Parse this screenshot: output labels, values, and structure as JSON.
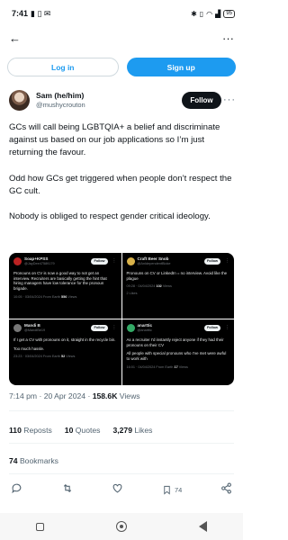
{
  "status_bar": {
    "time": "7:41",
    "battery": "95"
  },
  "nav": {
    "back_icon": "arrow-left-icon",
    "more_icon": "more-icon"
  },
  "auth": {
    "login_label": "Log in",
    "signup_label": "Sign up"
  },
  "author": {
    "name": "Sam (he/him)",
    "handle": "@mushycrouton",
    "follow_label": "Follow"
  },
  "tweet": {
    "paragraphs": [
      "GCs will call being LGBTQIA+ a belief and discriminate against us based on our job applications so I’m just returning the favour.",
      "Odd how GCs get triggered when people don’t respect the GC cult.",
      "Nobody is obliged to respect gender critical ideology."
    ]
  },
  "embedded_cards": [
    {
      "name": "Soap+KPSS",
      "handle": "@JayDee47589179",
      "follow": "Follow",
      "body": [
        "Pronouns on CV is now a good way to not get an interview.  Recruiters are basically getting the hint that hiring managers have low tolerance for the pronoun brigade."
      ],
      "meta": "10:05 · 03/04/2024 From Earth",
      "views_num": "556",
      "views_word": "Views"
    },
    {
      "name": "Craft Beer Snob",
      "handle": "@AnIdependentBloke",
      "follow": "Follow",
      "body": [
        "Pronouns on CV or LinkedIn = no interview. Avoid like the plague"
      ],
      "meta": "09:28 · 04/04/2024",
      "views_num": "102",
      "views_word": "Views",
      "likes": "2 Likes"
    },
    {
      "name": "Mandi B",
      "handle": "@MandiBe19",
      "follow": "Follow",
      "body": [
        "If I get a CV with pronouns on it, straight in the recycle bin.",
        "Too much hassle."
      ],
      "meta": "23:23 · 03/04/2024 From Earth",
      "views_num": "52",
      "views_word": "Views"
    },
    {
      "name": "anarttic",
      "handle": "@anarttic",
      "follow": "Follow",
      "body": [
        "As a recruiter I’d instantly reject anyone if they had their pronouns on their CV",
        "All people with special pronouns who I’ve met were awful to work with"
      ],
      "meta": "16:01 · 04/04/2024 From Earth",
      "views_num": "17",
      "views_word": "Views"
    }
  ],
  "timestamp": {
    "time": "7:14 pm",
    "separator1": " · ",
    "date": "20 Apr 2024",
    "separator2": " · ",
    "views_num": "158.6K",
    "views_word": " Views"
  },
  "stats": {
    "reposts_num": "110",
    "reposts_word": " Reposts",
    "quotes_num": "10",
    "quotes_word": " Quotes",
    "likes_num": "3,279",
    "likes_word": " Likes"
  },
  "bookmarks": {
    "num": "74",
    "word": " Bookmarks"
  },
  "actions": {
    "reply_icon": "reply-icon",
    "repost_icon": "repost-icon",
    "like_icon": "heart-icon",
    "bookmark_icon": "bookmark-icon",
    "bookmark_count": "74",
    "share_icon": "share-icon"
  }
}
